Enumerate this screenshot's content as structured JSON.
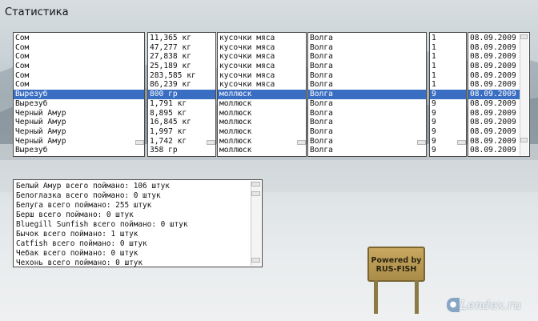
{
  "window": {
    "title": "Статистика"
  },
  "catch_table": {
    "rows": [
      {
        "fish": "Сом",
        "weight": "11,365 кг",
        "bait": "кусочки мяса",
        "place": "Волга",
        "num": "1",
        "date": "08.09.2009"
      },
      {
        "fish": "Сом",
        "weight": "47,277 кг",
        "bait": "кусочки мяса",
        "place": "Волга",
        "num": "1",
        "date": "08.09.2009"
      },
      {
        "fish": "Сом",
        "weight": "27,838 кг",
        "bait": "кусочки мяса",
        "place": "Волга",
        "num": "1",
        "date": "08.09.2009"
      },
      {
        "fish": "Сом",
        "weight": "25,189 кг",
        "bait": "кусочки мяса",
        "place": "Волга",
        "num": "1",
        "date": "08.09.2009"
      },
      {
        "fish": "Сом",
        "weight": "283,585 кг",
        "bait": "кусочки мяса",
        "place": "Волга",
        "num": "1",
        "date": "08.09.2009"
      },
      {
        "fish": "Сом",
        "weight": "86,239 кг",
        "bait": "кусочки мяса",
        "place": "Волга",
        "num": "1",
        "date": "08.09.2009"
      },
      {
        "fish": "Вырезуб",
        "weight": "800 гр",
        "bait": "моллюск",
        "place": "Волга",
        "num": "9",
        "date": "08.09.2009"
      },
      {
        "fish": "Вырезуб",
        "weight": "1,791 кг",
        "bait": "моллюск",
        "place": "Волга",
        "num": "9",
        "date": "08.09.2009"
      },
      {
        "fish": "Черный Амур",
        "weight": "8,895 кг",
        "bait": "моллюск",
        "place": "Волга",
        "num": "9",
        "date": "08.09.2009"
      },
      {
        "fish": "Черный Амур",
        "weight": "16,845 кг",
        "bait": "моллюск",
        "place": "Волга",
        "num": "9",
        "date": "08.09.2009"
      },
      {
        "fish": "Черный Амур",
        "weight": "1,997 кг",
        "bait": "моллюск",
        "place": "Волга",
        "num": "9",
        "date": "08.09.2009"
      },
      {
        "fish": "Черный Амур",
        "weight": "1,742 кг",
        "bait": "моллюск",
        "place": "Волга",
        "num": "9",
        "date": "08.09.2009"
      },
      {
        "fish": "Вырезуб",
        "weight": "358 гр",
        "bait": "моллюск",
        "place": "Волга",
        "num": "9",
        "date": "08.09.2009"
      }
    ],
    "selected_index": 6,
    "selection_color": "#3a6ec2"
  },
  "summary": {
    "lines": [
      "Белый Амур всего поймано: 106 штук",
      "Белоглазка всего поймано: 0 штук",
      "Белуга всего поймано: 255 штук",
      "Берш всего поймано: 0 штук",
      "Bluegill Sunfish всего поймано: 0 штук",
      "Бычок всего поймано: 1 штук",
      "Catfish всего поймано: 0 штук",
      "Чебак всего поймано: 0 штук",
      "Чехонь всего поймано: 0 штук"
    ]
  },
  "sign": {
    "line1": "Powered by",
    "line2": "RUS-FISH"
  },
  "watermark": {
    "text": "Lendex.ru"
  }
}
